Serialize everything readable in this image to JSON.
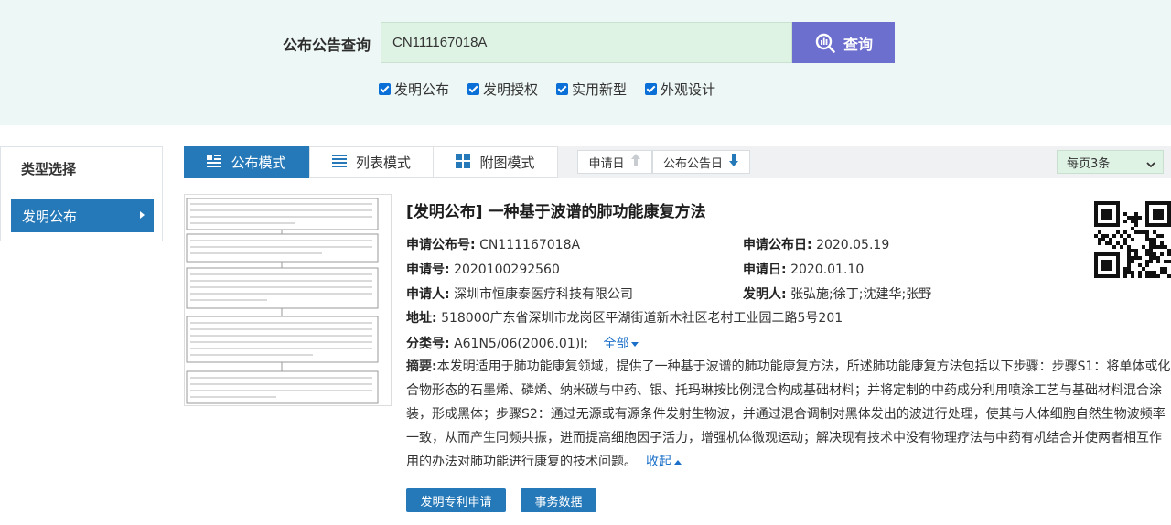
{
  "search": {
    "label": "公布公告查询",
    "value": "CN111167018A",
    "button_label": "查询",
    "filters": [
      "发明公布",
      "发明授权",
      "实用新型",
      "外观设计"
    ]
  },
  "sidebar": {
    "title": "类型选择",
    "items": [
      {
        "label": "发明公布"
      }
    ]
  },
  "toolbar": {
    "tabs": [
      {
        "label": "公布模式"
      },
      {
        "label": "列表模式"
      },
      {
        "label": "附图模式"
      }
    ],
    "sort": [
      {
        "label": "申请日"
      },
      {
        "label": "公布公告日"
      }
    ],
    "per_page": "每页3条"
  },
  "result": {
    "title": "[发明公布] 一种基于波谱的肺功能康复方法",
    "pub_no_label": "申请公布号:",
    "pub_no": "CN111167018A",
    "pub_date_label": "申请公布日:",
    "pub_date": "2020.05.19",
    "app_no_label": "申请号:",
    "app_no": "2020100292560",
    "app_date_label": "申请日:",
    "app_date": "2020.01.10",
    "applicant_label": "申请人:",
    "applicant": "深圳市恒康泰医疗科技有限公司",
    "inventor_label": "发明人:",
    "inventor": "张弘施;徐丁;沈建华;张野",
    "address_label": "地址:",
    "address": "518000广东省深圳市龙岗区平湖街道新木社区老村工业园二路5号201",
    "class_label": "分类号:",
    "class_no": "A61N5/06(2006.01)I;",
    "class_all": "全部",
    "abstract_label": "摘要:",
    "abstract": "本发明适用于肺功能康复领域，提供了一种基于波谱的肺功能康复方法，所述肺功能康复方法包括以下步骤：步骤S1：将单体或化合物形态的石墨烯、磷烯、纳米碳与中药、银、托玛琳按比例混合构成基础材料；并将定制的中药成分利用喷涂工艺与基础材料混合涂装，形成黑体；步骤S2：通过无源或有源条件发射生物波，并通过混合调制对黑体发出的波进行处理，使其与人体细胞自然生物波频率一致，从而产生同频共振，进而提高细胞因子活力，增强机体微观运动；解决现有技术中没有物理疗法与中药有机结合并使两者相互作用的办法对肺功能进行康复的技术问题。",
    "collapse": "收起",
    "buttons": [
      "发明专利申请",
      "事务数据"
    ]
  }
}
